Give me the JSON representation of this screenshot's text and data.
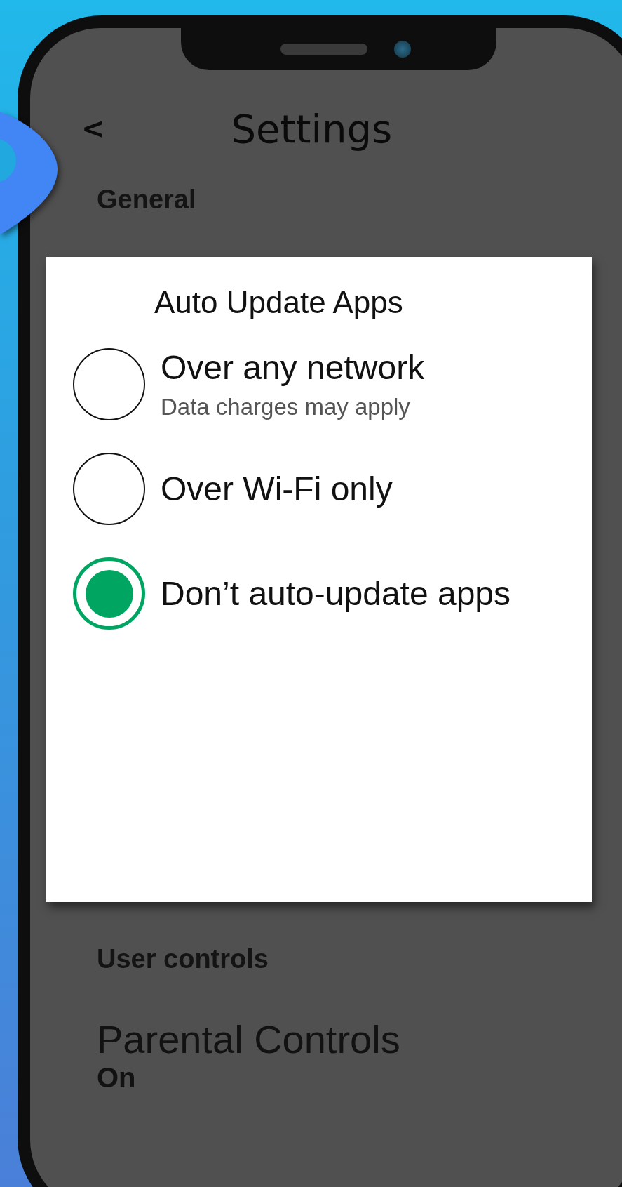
{
  "header": {
    "back": "<",
    "title": "Settings"
  },
  "sections": [
    {
      "label": "General"
    }
  ],
  "dialog": {
    "title": "Auto Update Apps",
    "options": [
      {
        "label": "Over any network",
        "subtitle": "Data charges may apply",
        "selected": false
      },
      {
        "label": "Over Wi-Fi only",
        "selected": false
      },
      {
        "label": "Don’t auto-update apps",
        "selected": true
      }
    ]
  },
  "below": {
    "section": "User controls",
    "item": {
      "title": "Parental Controls",
      "value": "On"
    }
  }
}
